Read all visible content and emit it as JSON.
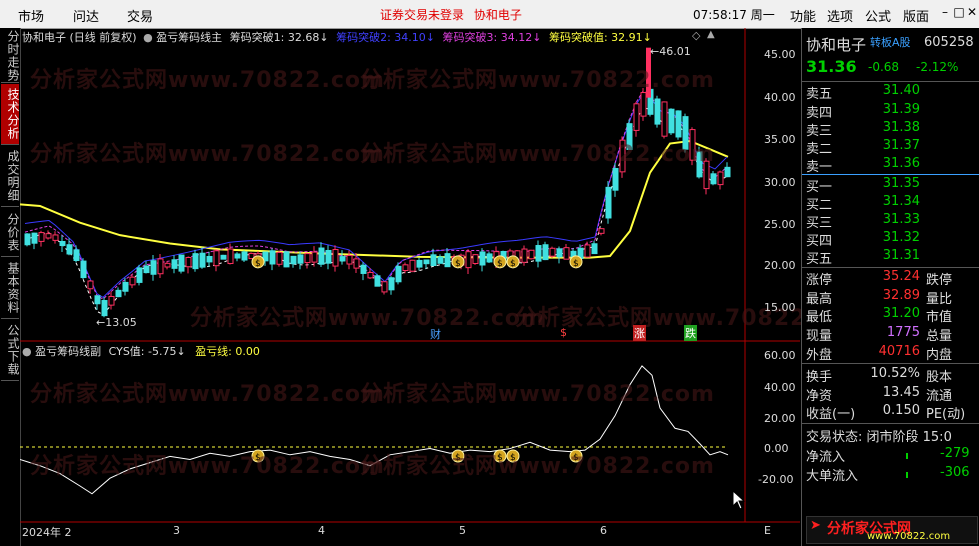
{
  "menubar": {
    "items": [
      "市场",
      "问达",
      "交易"
    ],
    "login_text": "证券交易未登录",
    "stock_name": "协和电子",
    "clock": "07:58:17 周一",
    "right_items": [
      "功能",
      "选项",
      "公式",
      "版面"
    ],
    "win_buttons": [
      "–",
      "□",
      "✕"
    ]
  },
  "left_tabs": [
    "分时走势",
    "技术分析",
    "成交明细",
    "分价表",
    "基本资料",
    "公式下载"
  ],
  "left_tabs_active": 1,
  "main_chart": {
    "title": "协和电子 (日线 前复权)",
    "indicator_name": "盈亏筹码线主",
    "break1": "筹码突破1: 32.68↓",
    "break2": "筹码突破2: 34.10↓",
    "break3": "筹码突破3: 34.12↓",
    "break_value": "筹码突破值: 32.91↓",
    "high_label": "46.01",
    "low_label": "13.05",
    "y_ticks": [
      "45.00",
      "40.00",
      "35.00",
      "30.00",
      "25.00",
      "20.00",
      "15.00"
    ],
    "markers": {
      "cai": "财",
      "dollar": "$",
      "zhang": "涨",
      "die": "跌"
    }
  },
  "sub_chart": {
    "title": "盈亏筹码线副",
    "cys": "CYS值: -5.75↓",
    "profit_line": "盈亏线: 0.00",
    "y_ticks": [
      "60.00",
      "40.00",
      "20.00",
      "0.00",
      "-20.00"
    ]
  },
  "x_axis": [
    "2024年 2",
    "3",
    "4",
    "5",
    "6",
    "E"
  ],
  "watermark": "分析家公式网www.70822.com",
  "panel": {
    "name": "协和电子",
    "board": "转板A股",
    "code": "605258",
    "price": "31.36",
    "change": "-0.68",
    "change_pct": "-2.12%",
    "asks": [
      {
        "label": "卖五",
        "price": "31.40"
      },
      {
        "label": "卖四",
        "price": "31.39"
      },
      {
        "label": "卖三",
        "price": "31.38"
      },
      {
        "label": "卖二",
        "price": "31.37"
      },
      {
        "label": "卖一",
        "price": "31.36"
      }
    ],
    "bids": [
      {
        "label": "买一",
        "price": "31.35"
      },
      {
        "label": "买二",
        "price": "31.34"
      },
      {
        "label": "买三",
        "price": "31.33"
      },
      {
        "label": "买四",
        "price": "31.32"
      },
      {
        "label": "买五",
        "price": "31.31"
      }
    ],
    "stats": [
      {
        "label": "涨停",
        "value": "35.24",
        "right": "跌停",
        "color": "red"
      },
      {
        "label": "最高",
        "value": "32.89",
        "right": "量比",
        "color": "red"
      },
      {
        "label": "最低",
        "value": "31.20",
        "right": "市值",
        "color": "green"
      },
      {
        "label": "现量",
        "value": "1775",
        "right": "总量",
        "color": "purple"
      },
      {
        "label": "外盘",
        "value": "40716",
        "right": "内盘",
        "color": "red"
      }
    ],
    "stats2": [
      {
        "label": "换手",
        "value": "10.52%",
        "right": "股本"
      },
      {
        "label": "净资",
        "value": "13.45",
        "right": "流通"
      },
      {
        "label": "收益(一)",
        "value": "0.150",
        "right": "PE(动)"
      }
    ],
    "trade_status": "交易状态: 闭市阶段 15:0",
    "net_inflow_label": "净流入",
    "net_inflow_value": "-279",
    "big_inflow_label": "大单流入",
    "big_inflow_value": "-306",
    "logo_text": "分析家公式网",
    "logo_url": "www.70822.com"
  }
}
